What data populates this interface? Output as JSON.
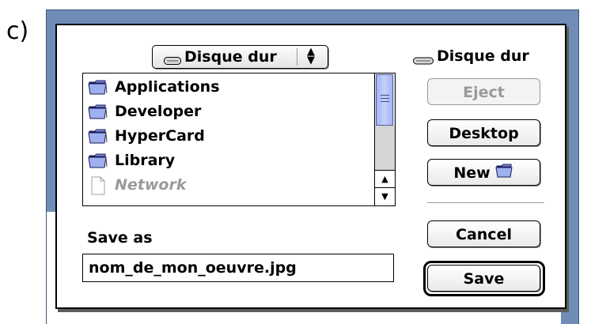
{
  "figure_label": "c)",
  "dialog": {
    "location_popup": {
      "label": "Disque dur",
      "icon": "hard-disk-icon"
    },
    "volume": {
      "label": "Disque dur",
      "icon": "hard-disk-icon"
    },
    "file_list": {
      "items": [
        {
          "label": "Applications",
          "icon": "folder-icon",
          "enabled": true
        },
        {
          "label": "Developer",
          "icon": "folder-icon",
          "enabled": true
        },
        {
          "label": "HyperCard",
          "icon": "folder-icon",
          "enabled": true
        },
        {
          "label": "Library",
          "icon": "folder-icon",
          "enabled": true
        },
        {
          "label": "Network",
          "icon": "document-icon",
          "enabled": false
        }
      ]
    },
    "buttons": {
      "eject": "Eject",
      "desktop": "Desktop",
      "new": "New",
      "cancel": "Cancel",
      "save": "Save"
    },
    "save_as": {
      "label": "Save as",
      "value": "nom_de_mon_oeuvre.jpg"
    }
  },
  "colors": {
    "background_window": "#6f8db7",
    "scroll_thumb": "#a5b3f2",
    "disabled_text": "#9a9a9a"
  }
}
